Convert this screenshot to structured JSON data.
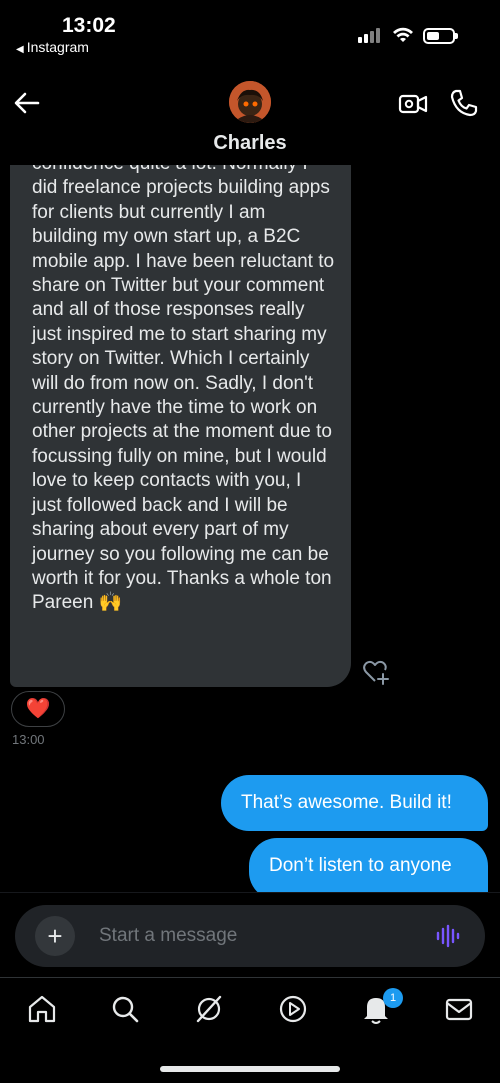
{
  "status_bar": {
    "time": "13:02",
    "back_app": "Instagram"
  },
  "header": {
    "contact_name": "Charles",
    "icons": [
      "back-arrow-icon",
      "video-camera-icon",
      "phone-icon"
    ]
  },
  "conversation": {
    "incoming_message": {
      "text": "confidence quite a lot. Normally I did freelance projects building apps for clients but currently I am building my own start up, a B2C mobile app. I have been reluctant to share on Twitter but your comment and all of those responses really just inspired me to start sharing my story on Twitter. Which I certainly will do from now on. Sadly, I don't currently have the time to work on other projects at the moment due to focussing fully on mine, but I would love to keep contacts with you, I just followed back and I will be sharing about every part of my journey so you following me can be worth it for you. Thanks a whole ton Pareen 🙌",
      "reaction": "❤️",
      "time": "13:00"
    },
    "outgoing_messages": [
      {
        "text": "That’s awesome. Build it!"
      },
      {
        "text": "Don’t listen to anyone"
      }
    ]
  },
  "composer": {
    "placeholder": "Start a message",
    "plus_label": "+"
  },
  "tab_bar": {
    "items": [
      "home-icon",
      "search-icon",
      "grok-icon",
      "video-icon",
      "notifications-icon",
      "messages-icon"
    ],
    "notifications_badge": "1"
  },
  "colors": {
    "accent": "#1d9bf0",
    "incoming_bubble": "#2f3336",
    "background": "#000000",
    "voice_icon": "#7856ff"
  }
}
